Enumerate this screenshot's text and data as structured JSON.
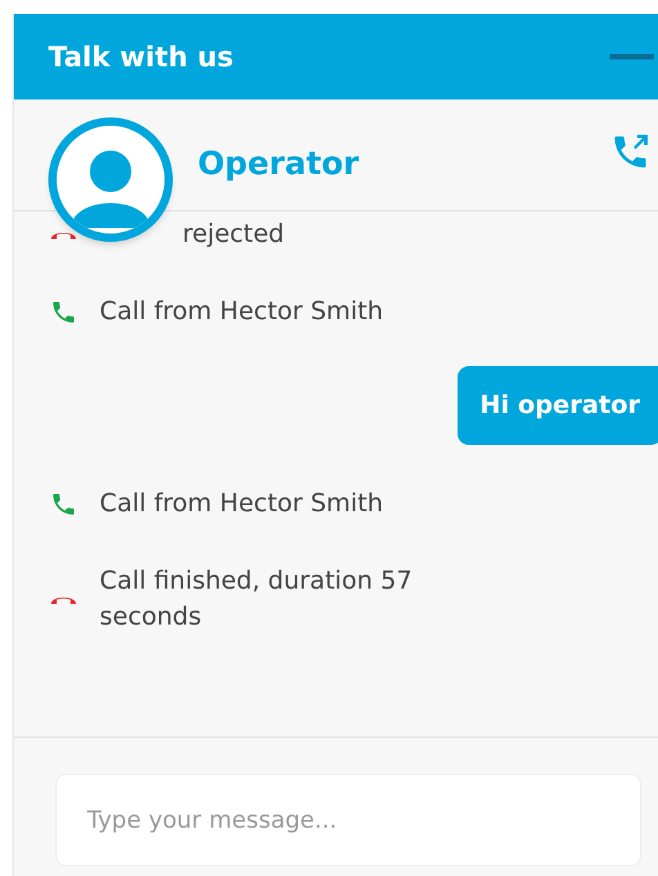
{
  "header": {
    "title": "Talk with us"
  },
  "agent": {
    "name": "Operator"
  },
  "messages": [
    {
      "kind": "call_ended",
      "text": "rejected"
    },
    {
      "kind": "call_incoming",
      "text": "Call from Hector Smith"
    },
    {
      "kind": "outgoing",
      "text": "Hi operator"
    },
    {
      "kind": "call_incoming",
      "text": "Call from Hector Smith"
    },
    {
      "kind": "call_ended",
      "text": "Call finished, duration 57 seconds"
    }
  ],
  "composer": {
    "placeholder": "Type your message..."
  }
}
